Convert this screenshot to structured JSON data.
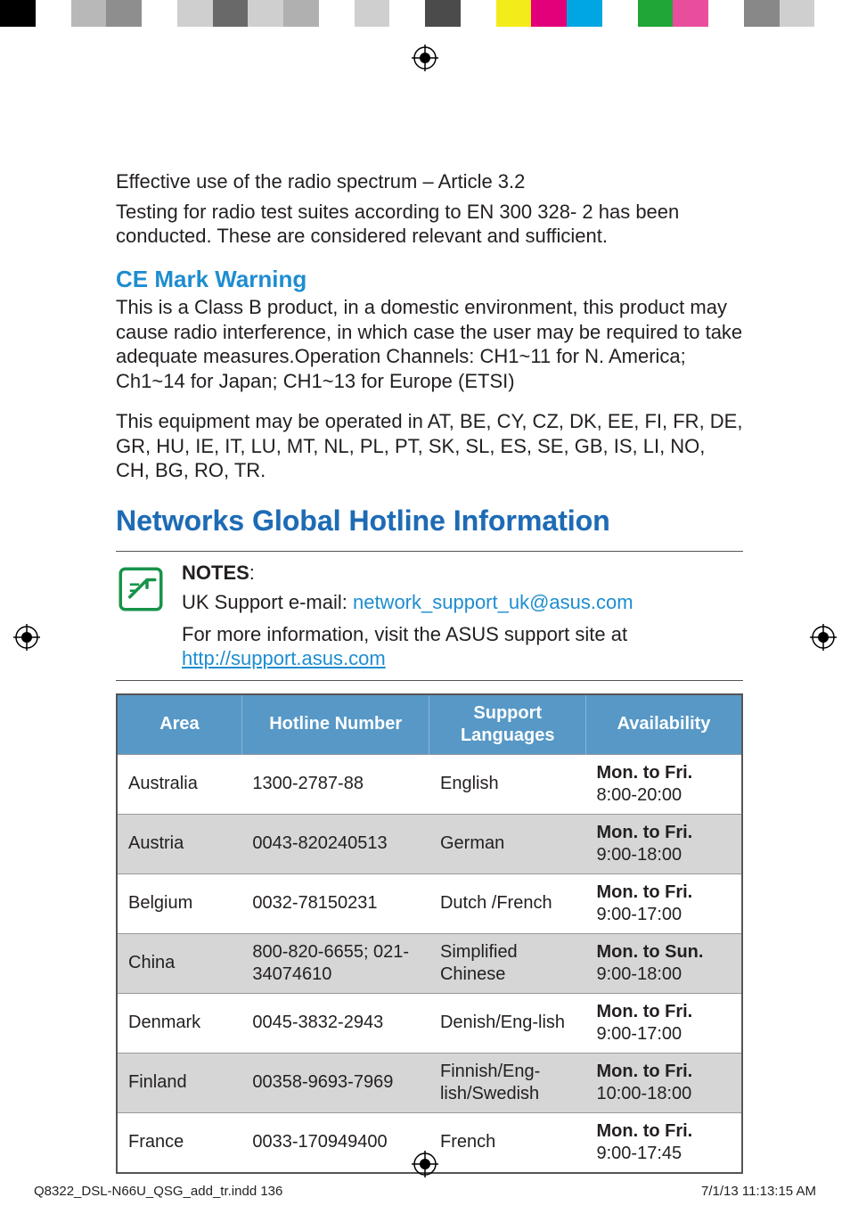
{
  "colorbar_top": [
    "#000000",
    "#ffffff",
    "#b8b8b8",
    "#8e8e8e",
    "#ffffff",
    "#cfcfcf",
    "#696969",
    "#cfcfcf",
    "#b0b0b0",
    "#ffffff",
    "#cfcfcf",
    "#ffffff",
    "#4b4b4b",
    "#ffffff",
    "#f3ec1a",
    "#e2007a",
    "#00a6e2",
    "#ffffff",
    "#20a637",
    "#e94e9c",
    "#ffffff",
    "#888888",
    "#cfcfcf",
    "#ffffff"
  ],
  "intro": {
    "line1": "Effective use of the radio spectrum – Article 3.2",
    "line2": "Testing for radio test suites according to EN 300 328- 2 has been conducted. These are considered relevant and sufficient."
  },
  "ce": {
    "heading": "CE Mark Warning",
    "p1": "This is a Class B product, in a domestic environment, this product may cause radio interference, in which case the user may be required to take adequate measures.Operation Channels: CH1~11 for N. America; Ch1~14 for Japan; CH1~13 for Europe (ETSI)",
    "p2": "This equipment may be operated in AT, BE, CY, CZ, DK, EE, FI, FR, DE, GR, HU, IE, IT, LU, MT, NL, PL, PT, SK, SL, ES, SE, GB, IS, LI, NO, CH, BG, RO, TR."
  },
  "hotline_heading": "Networks Global Hotline Information",
  "notes": {
    "label": "NOTES",
    "colon": ":",
    "uk_prefix": "UK Support e-mail: ",
    "uk_email": "network_support_uk@asus.com",
    "info_prefix": "For more information, visit the ASUS support site at ",
    "url": "http://support.asus.com"
  },
  "table": {
    "headers": [
      "Area",
      "Hotline Number",
      "Support Languages",
      "Availability"
    ],
    "rows": [
      {
        "area": "Australia",
        "num": "1300-2787-88",
        "lang": "English",
        "days": "Mon. to Fri.",
        "hours": "8:00-20:00",
        "alt": false
      },
      {
        "area": "Austria",
        "num": "0043-820240513",
        "lang": "German",
        "days": "Mon. to Fri.",
        "hours": "9:00-18:00",
        "alt": true
      },
      {
        "area": "Belgium",
        "num": "0032-78150231",
        "lang": "Dutch /French",
        "days": "Mon. to Fri.",
        "hours": "9:00-17:00",
        "alt": false
      },
      {
        "area": "China",
        "num": "800-820-6655; 021-34074610",
        "lang": "Simplified Chinese",
        "days": "Mon. to Sun.",
        "hours": "9:00-18:00",
        "alt": true
      },
      {
        "area": "Denmark",
        "num": "0045-3832-2943",
        "lang": "Denish/Eng-lish",
        "days": "Mon. to Fri.",
        "hours": "9:00-17:00",
        "alt": false
      },
      {
        "area": "Finland",
        "num": "00358-9693-7969",
        "lang": "Finnish/Eng-lish/Swedish",
        "days": "Mon. to Fri.",
        "hours": "10:00-18:00",
        "alt": true
      },
      {
        "area": "France",
        "num": "0033-170949400",
        "lang": "French",
        "days": "Mon. to Fri.",
        "hours": "9:00-17:45",
        "alt": false
      }
    ]
  },
  "footer": {
    "left": "Q8322_DSL-N66U_QSG_add_tr.indd   136",
    "right": "7/1/13   11:13:15 AM"
  }
}
